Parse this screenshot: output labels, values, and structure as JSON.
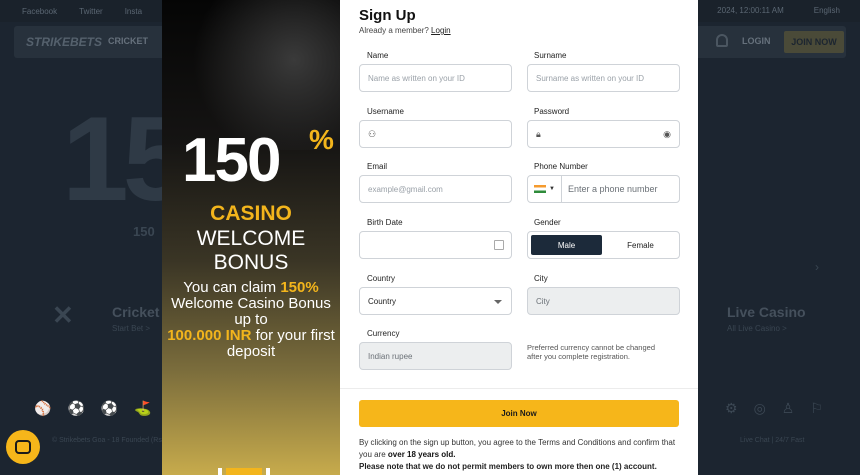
{
  "background": {
    "topbar": [
      "Facebook",
      "Twitter",
      "Insta"
    ],
    "topbar_right": [
      "2024, 12:00:11 AM",
      "English"
    ],
    "logo": "STRIKEBETS",
    "nav_cricket": "CRICKET",
    "login": "LOGIN",
    "join_now": "JOIN NOW",
    "big_text": "15",
    "small_150": "150",
    "cricket_title": "Cricket",
    "cricket_sub": "Start Bet >",
    "live_title": "Live Casino",
    "live_sub": "All Live Casino >",
    "footer_left": "© Strikebets Goa - 18 Founded (Rs)",
    "footer_right": "Live Chat | 24/7 Fast"
  },
  "promo": {
    "big_number": "150",
    "percent": "%",
    "casino": "CASINO",
    "welcome": "WELCOME",
    "bonus": "BONUS",
    "desc_1": "You can claim ",
    "desc_hl_1": "150%",
    "desc_2": "Welcome Casino Bonus up to",
    "desc_hl_2": "100.000 INR",
    "desc_3": " for your first deposit"
  },
  "form": {
    "title": "Sign Up",
    "already": "Already a member?",
    "login_link": "Login",
    "name_label": "Name",
    "name_placeholder": "Name as written on your ID",
    "surname_label": "Surname",
    "surname_placeholder": "Surname as written on your ID",
    "username_label": "Username",
    "password_label": "Password",
    "email_label": "Email",
    "email_placeholder": "example@gmail.com",
    "phone_label": "Phone Number",
    "phone_placeholder": "Enter a phone number",
    "birth_label": "Birth Date",
    "gender_label": "Gender",
    "gender_male": "Male",
    "gender_female": "Female",
    "country_label": "Country",
    "country_value": "Country",
    "city_label": "City",
    "city_value": "City",
    "currency_label": "Currency",
    "currency_value": "Indian rupee",
    "currency_note": "Preferred currency cannot be changed after you complete registration.",
    "join_button": "Join Now",
    "terms_1": "By clicking on the sign up button, you agree to the Terms and Conditions and confirm that you are ",
    "terms_bold": "over 18 years old.",
    "warning": "Please note that we do not permit members to own more then one (1) account."
  },
  "colors": {
    "accent": "#f6b61a",
    "selected": "#1c2a3a",
    "promo_yellow": "#f3b51c"
  }
}
